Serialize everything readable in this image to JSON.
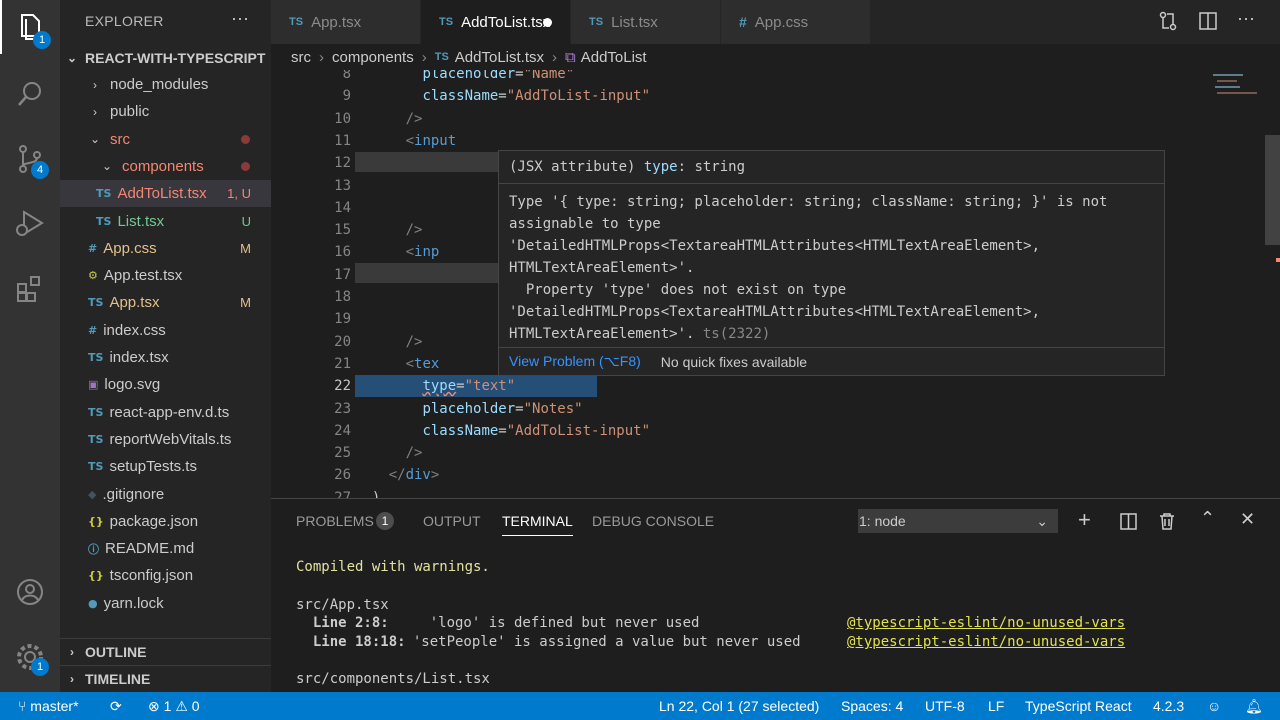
{
  "activity": {
    "explorer_badge": "1",
    "scm_badge": "4",
    "settings_badge": "1"
  },
  "sidebar": {
    "title": "EXPLORER",
    "more": "···",
    "project": "REACT-WITH-TYPESCRIPT",
    "items": [
      {
        "label": "node_modules",
        "type": "folder-collapsed"
      },
      {
        "label": "public",
        "type": "folder-collapsed"
      },
      {
        "label": "src",
        "type": "folder-open"
      },
      {
        "label": "components",
        "type": "folder-open"
      },
      {
        "label": "AddToList.tsx",
        "type": "tsx",
        "status": "1, U"
      },
      {
        "label": "List.tsx",
        "type": "tsx",
        "status": "U"
      },
      {
        "label": "App.css",
        "type": "css",
        "status": "M"
      },
      {
        "label": "App.test.tsx",
        "type": "test"
      },
      {
        "label": "App.tsx",
        "type": "tsx",
        "status": "M"
      },
      {
        "label": "index.css",
        "type": "css"
      },
      {
        "label": "index.tsx",
        "type": "tsx"
      },
      {
        "label": "logo.svg",
        "type": "svg"
      },
      {
        "label": "react-app-env.d.ts",
        "type": "ts"
      },
      {
        "label": "reportWebVitals.ts",
        "type": "ts"
      },
      {
        "label": "setupTests.ts",
        "type": "ts"
      },
      {
        "label": ".gitignore",
        "type": "git"
      },
      {
        "label": "package.json",
        "type": "json"
      },
      {
        "label": "README.md",
        "type": "md"
      },
      {
        "label": "tsconfig.json",
        "type": "json"
      },
      {
        "label": "yarn.lock",
        "type": "yarn"
      }
    ],
    "outline": "OUTLINE",
    "timeline": "TIMELINE"
  },
  "tabs": [
    {
      "label": "App.tsx",
      "icon": "TS"
    },
    {
      "label": "AddToList.tsx",
      "icon": "TS",
      "active": true
    },
    {
      "label": "List.tsx",
      "icon": "TS"
    },
    {
      "label": "App.css",
      "icon": "#"
    }
  ],
  "breadcrumb": {
    "a": "src",
    "b": "components",
    "c": "AddToList.tsx",
    "d": "AddToList"
  },
  "editor": {
    "lines": [
      {
        "n": "8",
        "text": "placeholder=\"Name\""
      },
      {
        "n": "9",
        "attr": "className",
        "val": "\"AddToList-input\""
      },
      {
        "n": "10",
        "text": "/>"
      },
      {
        "n": "11",
        "text": "<input"
      },
      {
        "n": "12",
        "text": ""
      },
      {
        "n": "13",
        "text": ""
      },
      {
        "n": "14",
        "text": ""
      },
      {
        "n": "15",
        "text": "/>"
      },
      {
        "n": "16",
        "text": "<inp"
      },
      {
        "n": "17",
        "text": ""
      },
      {
        "n": "18",
        "text": ""
      },
      {
        "n": "19",
        "text": ""
      },
      {
        "n": "20",
        "text": "/>"
      },
      {
        "n": "21",
        "text": "<tex"
      },
      {
        "n": "22",
        "attr": "type",
        "val": "\"text\""
      },
      {
        "n": "23",
        "attr": "placeholder",
        "val": "\"Notes\""
      },
      {
        "n": "24",
        "attr": "className",
        "val": "\"AddToList-input\""
      },
      {
        "n": "25",
        "text": "/>"
      },
      {
        "n": "26",
        "text": "</div>"
      },
      {
        "n": "27",
        "text": ")"
      }
    ]
  },
  "hover": {
    "sig_prefix": "(JSX attribute)",
    "sig_name": "type",
    "sig_type": ": string",
    "body": "Type '{ type: string; placeholder: string; className: string; }' is not\nassignable to type\n'DetailedHTMLProps<TextareaHTMLAttributes<HTMLTextAreaElement>,\nHTMLTextAreaElement>'.\n  Property 'type' does not exist on type\n'DetailedHTMLProps<TextareaHTMLAttributes<HTMLTextAreaElement>,\nHTMLTextAreaElement>'.",
    "code": "ts(2322)",
    "view_problem": "View Problem (⌥F8)",
    "no_fixes": "No quick fixes available"
  },
  "panel": {
    "tabs": [
      "PROBLEMS",
      "OUTPUT",
      "TERMINAL",
      "DEBUG CONSOLE"
    ],
    "problems_count": "1",
    "terminal_select": "1: node",
    "lines": {
      "l1": "Compiled with warnings.",
      "l2": "src/App.tsx",
      "l3a": "  Line 2:8:",
      "l3b": "    'logo' is defined but never used",
      "l3c": "@typescript-eslint/no-unused-vars",
      "l4a": "  Line 18:18:",
      "l4b": "  'setPeople' is assigned a value but never used",
      "l4c": "@typescript-eslint/no-unused-vars",
      "l5": "src/components/List.tsx"
    }
  },
  "status": {
    "branch": "master*",
    "errors": "1",
    "warnings": "0",
    "position": "Ln 22, Col 1 (27 selected)",
    "spaces": "Spaces: 4",
    "encoding": "UTF-8",
    "eol": "LF",
    "language": "TypeScript React",
    "version": "4.2.3"
  },
  "colors": {
    "accent": "#007acc",
    "untracked": "#73c991",
    "modified": "#e2c08d",
    "error": "#f48771",
    "link": "#3794ff"
  }
}
